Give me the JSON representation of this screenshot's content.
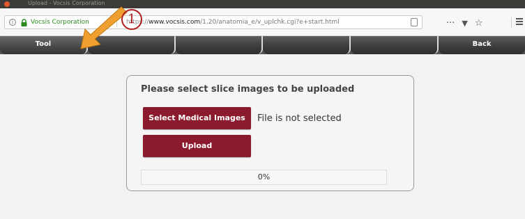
{
  "window": {
    "title": "Upload - Vocsis Corporation"
  },
  "browser": {
    "info_icon": "info-icon",
    "lock_icon": "lock-icon",
    "org_name": "Vocsis Corporation",
    "url_prefix": "https://",
    "url_host": "www.vocsis.com",
    "url_path": "/1.20/anatomia_e/v_uplchk.cgi?e+start.html",
    "more_glyph": "···",
    "pocket_glyph": "▼",
    "star_glyph": "☆"
  },
  "nav": {
    "tool_label": "Tool",
    "slot2_label": "",
    "slot3_label": "",
    "slot4_label": "",
    "slot5_label": "",
    "back_label": "Back"
  },
  "panel": {
    "title": "Please select slice images to be uploaded",
    "select_button": "Select Medical Images",
    "file_status": "File is not selected",
    "upload_button": "Upload",
    "progress_value": 0,
    "progress_text": "0%"
  },
  "annotation": {
    "step_number": "1",
    "arrow_icon": "orange-arrow-icon"
  },
  "colors": {
    "accent": "#8b1a2e",
    "nav_bg": "#3d3d3d",
    "org_green": "#2a8a1e",
    "annotation_red": "#b01e1e",
    "arrow_orange": "#f0a030"
  }
}
